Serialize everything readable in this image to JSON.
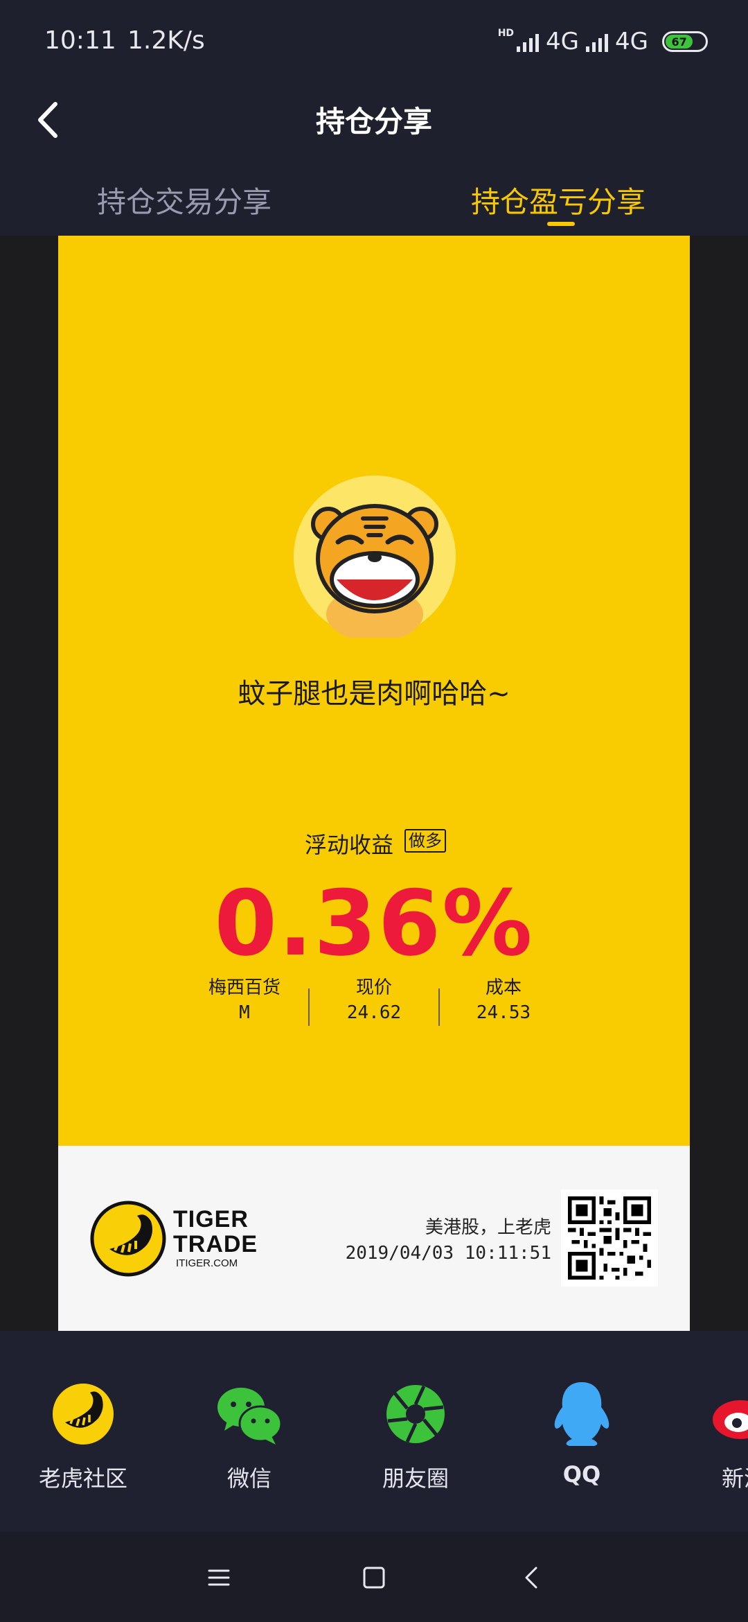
{
  "status_bar": {
    "time": "10:11",
    "speed": "1.2K/s",
    "hd": "HD",
    "network_1": "4G",
    "network_2": "4G",
    "battery": "67"
  },
  "header": {
    "title": "持仓分享"
  },
  "tabs": [
    {
      "label": "持仓交易分享",
      "active": false
    },
    {
      "label": "持仓盈亏分享",
      "active": true
    }
  ],
  "card": {
    "tagline": "蚊子腿也是肉啊哈哈~",
    "float_label": "浮动收益",
    "position_badge": "做多",
    "pnl_percent": "0.36%",
    "stats": [
      {
        "label": "梅西百货",
        "value": "M"
      },
      {
        "label": "现价",
        "value": "24.62"
      },
      {
        "label": "成本",
        "value": "24.53"
      }
    ],
    "brand_line1": "TIGER",
    "brand_line2": "TRADE",
    "brand_site": "ITIGER.COM",
    "slogan": "美港股，上老虎",
    "timestamp": "2019/04/03 10:11:51"
  },
  "share_targets": [
    {
      "label": "老虎社区",
      "icon": "tiger-community-icon"
    },
    {
      "label": "微信",
      "icon": "wechat-icon"
    },
    {
      "label": "朋友圈",
      "icon": "moments-icon"
    },
    {
      "label": "QQ",
      "icon": "qq-icon"
    },
    {
      "label": "新浪",
      "icon": "weibo-icon"
    }
  ],
  "colors": {
    "accent": "#f8c900",
    "card_bg": "#f9cc02",
    "gain": "#ee1a3c",
    "app_bg": "#1f202d"
  }
}
